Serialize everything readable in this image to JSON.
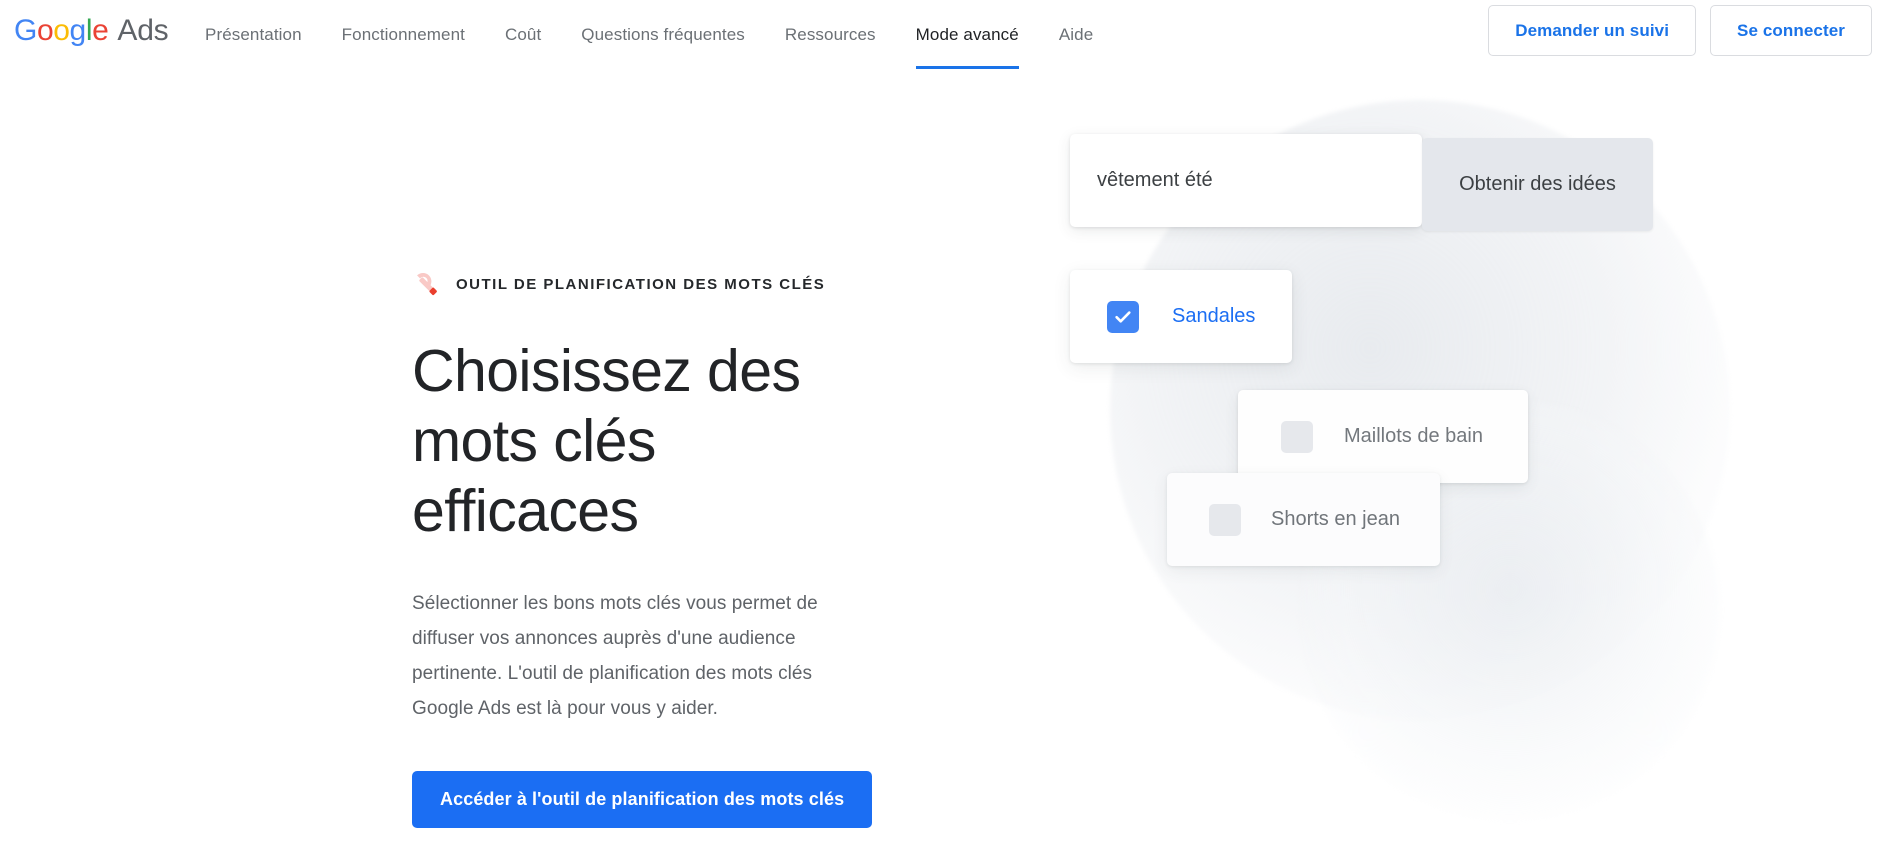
{
  "header": {
    "logo": {
      "brand_letters": [
        "G",
        "o",
        "o",
        "g",
        "l",
        "e"
      ],
      "product": "Ads"
    },
    "nav_items": [
      {
        "label": "Présentation",
        "active": false
      },
      {
        "label": "Fonctionnement",
        "active": false
      },
      {
        "label": "Coût",
        "active": false
      },
      {
        "label": "Questions fréquentes",
        "active": false
      },
      {
        "label": "Ressources",
        "active": false
      },
      {
        "label": "Mode avancé",
        "active": true
      },
      {
        "label": "Aide",
        "active": false
      }
    ],
    "actions": {
      "request_callback": "Demander un suivi",
      "sign_in": "Se connecter"
    }
  },
  "hero": {
    "eyebrow": "OUTIL DE PLANIFICATION DES MOTS CLÉS",
    "eyebrow_icon": "wrench-icon",
    "headline": "Choisissez des mots clés efficaces",
    "body": "Sélectionner les bons mots clés vous permet de diffuser vos annonces auprès d'une audience pertinente. L'outil de planification des mots clés Google Ads est là pour vous y aider.",
    "cta_label": "Accéder à l'outil de planification des mots clés"
  },
  "illustration": {
    "search": {
      "value": "vêtement été",
      "placeholder": "vêtement été",
      "button_label": "Obtenir des idées"
    },
    "keyword_cards": [
      {
        "label": "Sandales",
        "checked": true,
        "icon": "checkbox-checked-icon"
      },
      {
        "label": "Maillots de bain",
        "checked": false,
        "icon": "checkbox-unchecked-icon"
      },
      {
        "label": "Shorts en jean",
        "checked": false,
        "icon": "checkbox-unchecked-icon"
      }
    ]
  },
  "colors": {
    "accent_blue": "#1a73e8",
    "cta_blue": "#1b6ef3",
    "checkbox_blue": "#4285f4",
    "text_dark": "#222427",
    "text_muted": "#5f6368",
    "border_gray": "#dadce0",
    "button_gray": "#e4e7ec",
    "google_blue": "#4285F4",
    "google_red": "#EA4335",
    "google_yellow": "#FBBC05",
    "google_green": "#34A853"
  }
}
